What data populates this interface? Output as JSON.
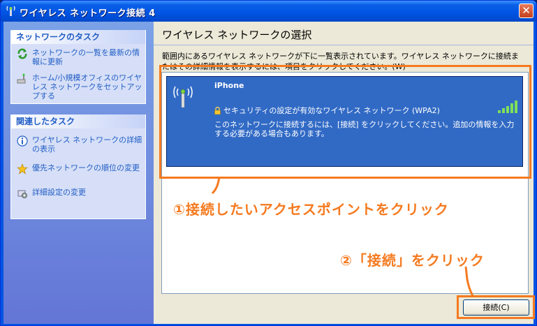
{
  "window": {
    "title": "ワイヤレス ネットワーク接続 4",
    "close_label": "✕"
  },
  "taskpane": {
    "network_tasks": {
      "header": "ネットワークのタスク",
      "items": [
        {
          "label": "ネットワークの一覧を最新の情報に更新",
          "icon": "refresh-icon"
        },
        {
          "label": "ホーム/小規模オフィスのワイヤレス ネットワークをセットアップする",
          "icon": "wireless-setup-icon"
        }
      ]
    },
    "related_tasks": {
      "header": "関連したタスク",
      "items": [
        {
          "label": "ワイヤレス ネットワークの詳細の表示",
          "icon": "info-icon"
        },
        {
          "label": "優先ネットワークの順位の変更",
          "icon": "star-icon"
        },
        {
          "label": "詳細設定の変更",
          "icon": "settings-icon"
        }
      ]
    }
  },
  "main": {
    "title": "ワイヤレス ネットワークの選択",
    "description": "範囲内にあるワイヤレス ネットワークが下に一覧表示されています。ワイヤレス ネットワークに接続またはその詳細情報を表示するには、項目をクリックしてください。(W)",
    "networks": [
      {
        "name": "iPhone",
        "security": "セキュリティの設定が有効なワイヤレス ネットワーク (WPA2)",
        "info": "このネットワークに接続するには、[接続] をクリックしてください。追加の情報を入力する必要がある場合もあります。",
        "signal_bars": 5,
        "signal_max": 5
      }
    ],
    "connect_button": "接続(C)"
  },
  "annotations": {
    "step1": "①接続したいアクセスポイントをクリック",
    "step2": "②「接続」をクリック",
    "color": "#f57a1f"
  },
  "colors": {
    "selection": "#316ac5",
    "titlebar": "#0054e3",
    "link": "#215dc6"
  }
}
